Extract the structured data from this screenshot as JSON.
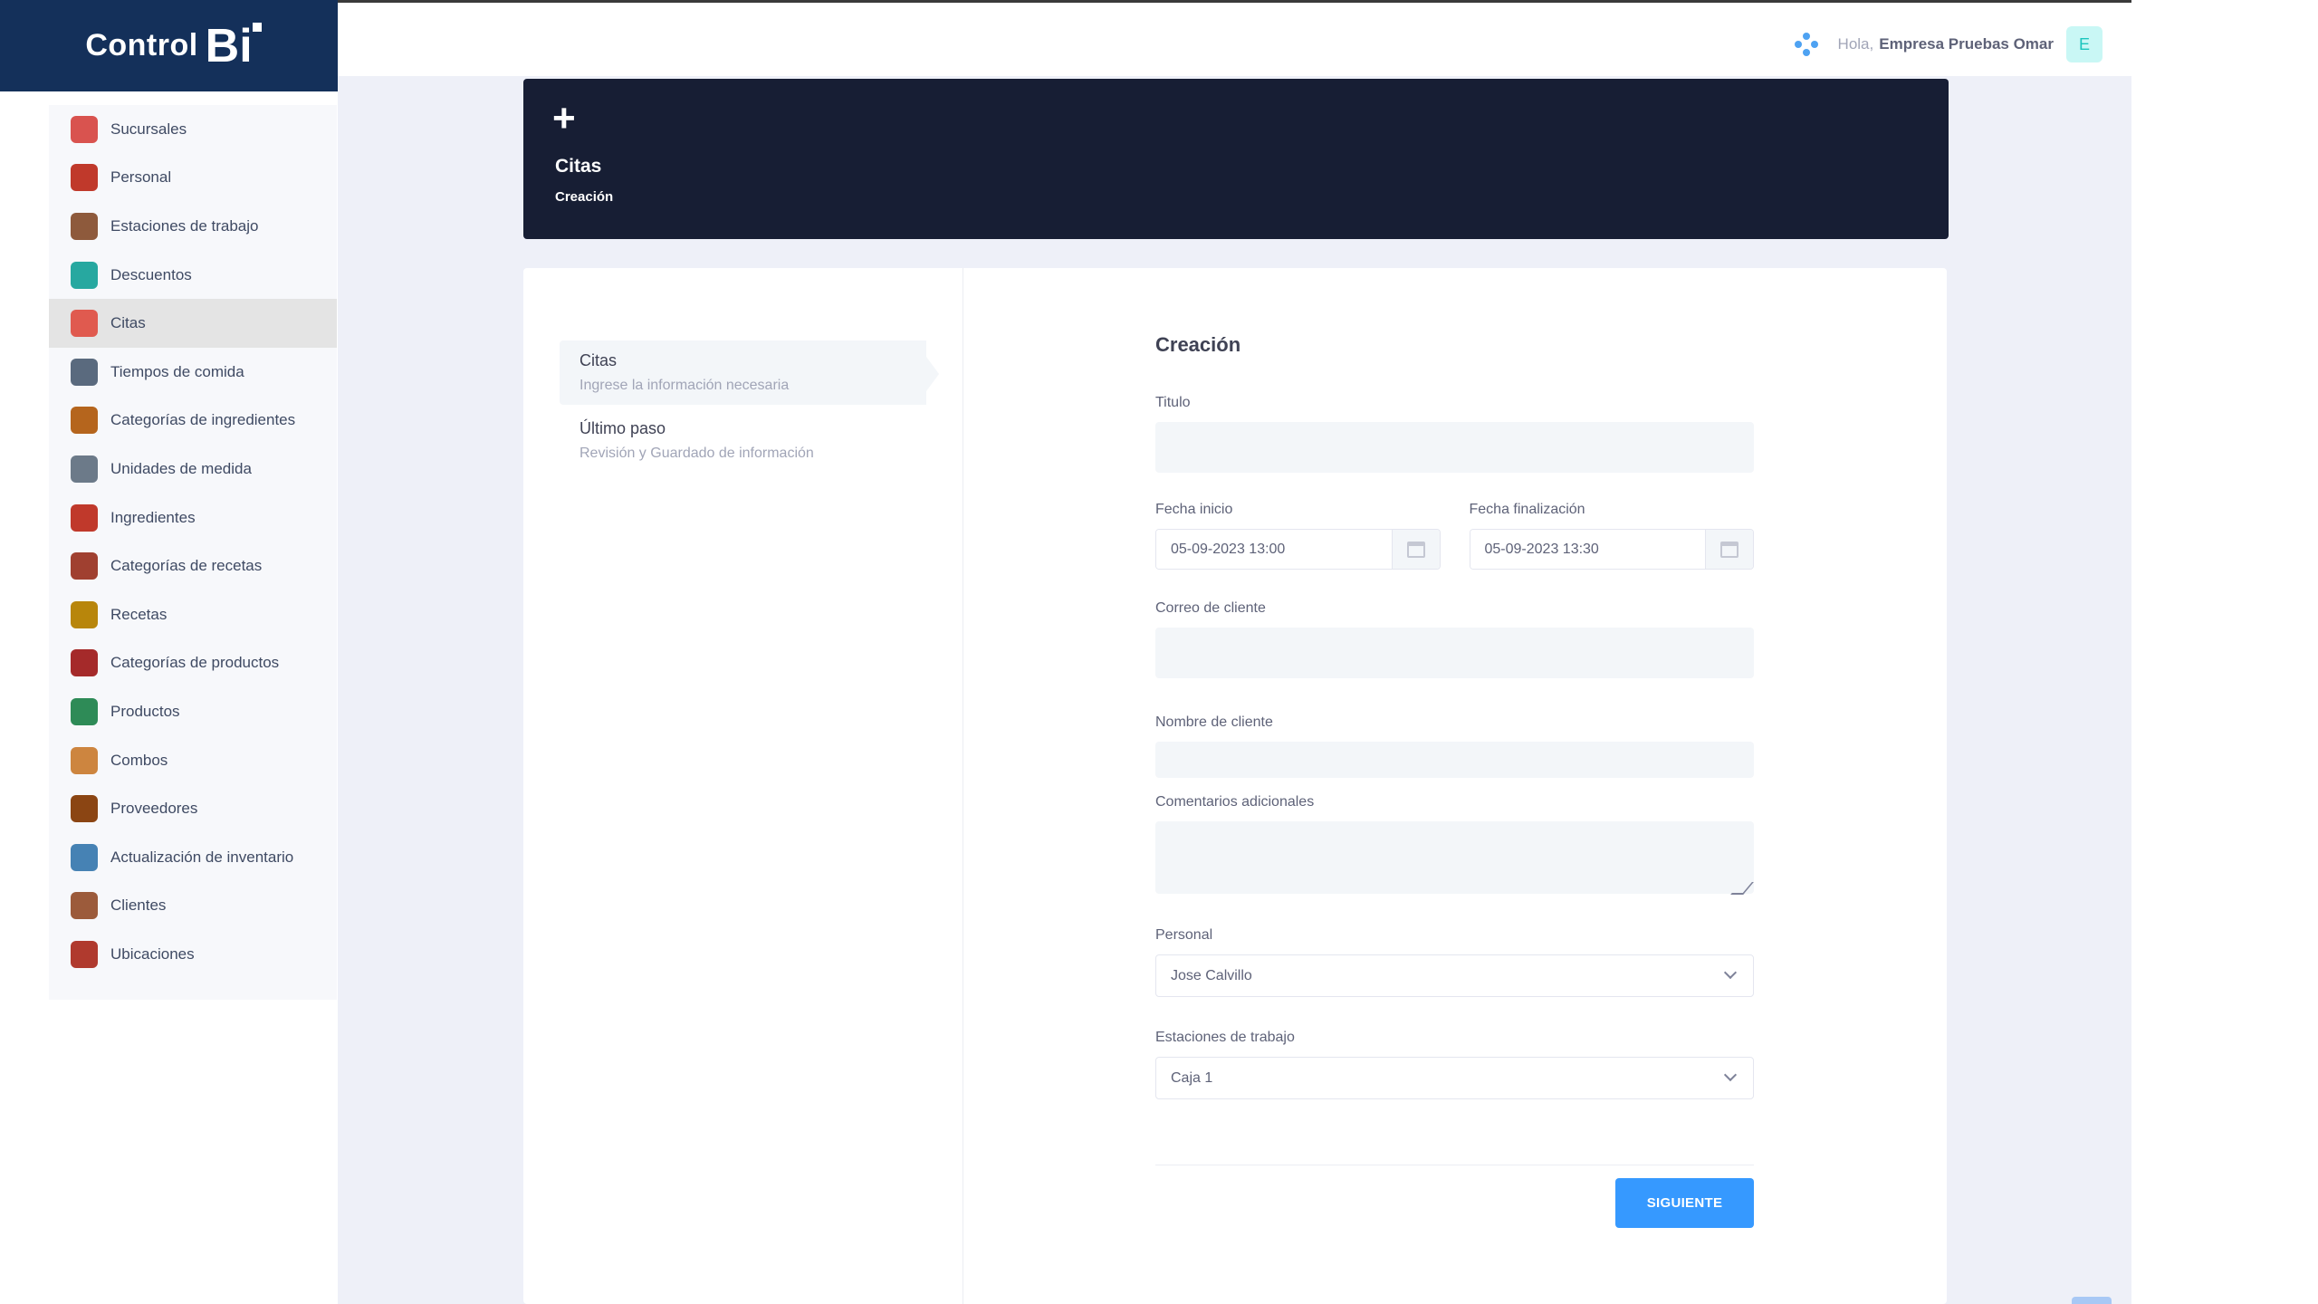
{
  "app": {
    "brand_text": "Control",
    "brand_mark": "Bi",
    "accent_color": "#3699ff",
    "brand_color": "#14305a"
  },
  "header": {
    "greeting": "Hola,",
    "user_name": "Empresa Pruebas Omar",
    "avatar_letter": "E"
  },
  "sidebar": {
    "items": [
      {
        "label": "Sucursales",
        "icon": "store-icon",
        "color": "#d9534f"
      },
      {
        "label": "Personal",
        "icon": "people-icon",
        "color": "#c0392b"
      },
      {
        "label": "Estaciones de trabajo",
        "icon": "workstation-icon",
        "color": "#8e5a3c"
      },
      {
        "label": "Descuentos",
        "icon": "discount-icon",
        "color": "#27a8a0"
      },
      {
        "label": "Citas",
        "icon": "calendar-icon",
        "color": "#e05a4f",
        "active": true
      },
      {
        "label": "Tiempos de comida",
        "icon": "meal-time-icon",
        "color": "#5a6a7e"
      },
      {
        "label": "Categorías de ingredientes",
        "icon": "ingredient-category-icon",
        "color": "#b5651d"
      },
      {
        "label": "Unidades de medida",
        "icon": "measure-icon",
        "color": "#6c7a89"
      },
      {
        "label": "Ingredientes",
        "icon": "ingredients-icon",
        "color": "#c0392b"
      },
      {
        "label": "Categorías de recetas",
        "icon": "recipe-category-icon",
        "color": "#a04030"
      },
      {
        "label": "Recetas",
        "icon": "recipe-icon",
        "color": "#b8860b"
      },
      {
        "label": "Categorías de productos",
        "icon": "product-category-icon",
        "color": "#a52a2a"
      },
      {
        "label": "Productos",
        "icon": "product-icon",
        "color": "#2e8b57"
      },
      {
        "label": "Combos",
        "icon": "combo-icon",
        "color": "#cd853f"
      },
      {
        "label": "Proveedores",
        "icon": "supplier-icon",
        "color": "#8b4513"
      },
      {
        "label": "Actualización de inventario",
        "icon": "inventory-icon",
        "color": "#4682b4"
      },
      {
        "label": "Clientes",
        "icon": "clients-icon",
        "color": "#9c5b3b"
      },
      {
        "label": "Ubicaciones",
        "icon": "location-pin-icon",
        "color": "#b03a2e"
      }
    ]
  },
  "hero": {
    "title": "Citas",
    "subtitle": "Creación"
  },
  "stepper": {
    "steps": [
      {
        "title": "Citas",
        "desc": "Ingrese la información necesaria"
      },
      {
        "title": "Último paso",
        "desc": "Revisión y Guardado de información"
      }
    ]
  },
  "form": {
    "title": "Creación",
    "titulo_label": "Titulo",
    "titulo_value": "",
    "fecha_inicio_label": "Fecha inicio",
    "fecha_inicio_value": "05-09-2023 13:00",
    "fecha_fin_label": "Fecha finalización",
    "fecha_fin_value": "05-09-2023 13:30",
    "correo_label": "Correo de cliente",
    "correo_value": "",
    "nombre_label": "Nombre de cliente",
    "nombre_value": "",
    "comentarios_label": "Comentarios adicionales",
    "comentarios_value": "",
    "personal_label": "Personal",
    "personal_value": "Jose Calvillo",
    "estaciones_label": "Estaciones de trabajo",
    "estaciones_value": "Caja 1",
    "submit_label": "SIGUIENTE"
  }
}
